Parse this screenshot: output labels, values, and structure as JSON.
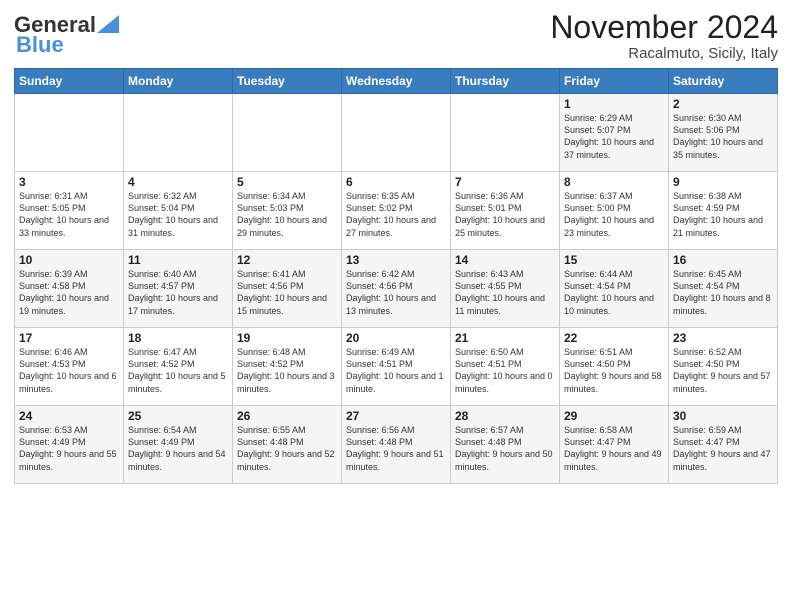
{
  "header": {
    "logo_general": "General",
    "logo_blue": "Blue",
    "month_title": "November 2024",
    "location": "Racalmuto, Sicily, Italy"
  },
  "days_of_week": [
    "Sunday",
    "Monday",
    "Tuesday",
    "Wednesday",
    "Thursday",
    "Friday",
    "Saturday"
  ],
  "weeks": [
    [
      {
        "day": "",
        "info": ""
      },
      {
        "day": "",
        "info": ""
      },
      {
        "day": "",
        "info": ""
      },
      {
        "day": "",
        "info": ""
      },
      {
        "day": "",
        "info": ""
      },
      {
        "day": "1",
        "info": "Sunrise: 6:29 AM\nSunset: 5:07 PM\nDaylight: 10 hours and 37 minutes."
      },
      {
        "day": "2",
        "info": "Sunrise: 6:30 AM\nSunset: 5:06 PM\nDaylight: 10 hours and 35 minutes."
      }
    ],
    [
      {
        "day": "3",
        "info": "Sunrise: 6:31 AM\nSunset: 5:05 PM\nDaylight: 10 hours and 33 minutes."
      },
      {
        "day": "4",
        "info": "Sunrise: 6:32 AM\nSunset: 5:04 PM\nDaylight: 10 hours and 31 minutes."
      },
      {
        "day": "5",
        "info": "Sunrise: 6:34 AM\nSunset: 5:03 PM\nDaylight: 10 hours and 29 minutes."
      },
      {
        "day": "6",
        "info": "Sunrise: 6:35 AM\nSunset: 5:02 PM\nDaylight: 10 hours and 27 minutes."
      },
      {
        "day": "7",
        "info": "Sunrise: 6:36 AM\nSunset: 5:01 PM\nDaylight: 10 hours and 25 minutes."
      },
      {
        "day": "8",
        "info": "Sunrise: 6:37 AM\nSunset: 5:00 PM\nDaylight: 10 hours and 23 minutes."
      },
      {
        "day": "9",
        "info": "Sunrise: 6:38 AM\nSunset: 4:59 PM\nDaylight: 10 hours and 21 minutes."
      }
    ],
    [
      {
        "day": "10",
        "info": "Sunrise: 6:39 AM\nSunset: 4:58 PM\nDaylight: 10 hours and 19 minutes."
      },
      {
        "day": "11",
        "info": "Sunrise: 6:40 AM\nSunset: 4:57 PM\nDaylight: 10 hours and 17 minutes."
      },
      {
        "day": "12",
        "info": "Sunrise: 6:41 AM\nSunset: 4:56 PM\nDaylight: 10 hours and 15 minutes."
      },
      {
        "day": "13",
        "info": "Sunrise: 6:42 AM\nSunset: 4:56 PM\nDaylight: 10 hours and 13 minutes."
      },
      {
        "day": "14",
        "info": "Sunrise: 6:43 AM\nSunset: 4:55 PM\nDaylight: 10 hours and 11 minutes."
      },
      {
        "day": "15",
        "info": "Sunrise: 6:44 AM\nSunset: 4:54 PM\nDaylight: 10 hours and 10 minutes."
      },
      {
        "day": "16",
        "info": "Sunrise: 6:45 AM\nSunset: 4:54 PM\nDaylight: 10 hours and 8 minutes."
      }
    ],
    [
      {
        "day": "17",
        "info": "Sunrise: 6:46 AM\nSunset: 4:53 PM\nDaylight: 10 hours and 6 minutes."
      },
      {
        "day": "18",
        "info": "Sunrise: 6:47 AM\nSunset: 4:52 PM\nDaylight: 10 hours and 5 minutes."
      },
      {
        "day": "19",
        "info": "Sunrise: 6:48 AM\nSunset: 4:52 PM\nDaylight: 10 hours and 3 minutes."
      },
      {
        "day": "20",
        "info": "Sunrise: 6:49 AM\nSunset: 4:51 PM\nDaylight: 10 hours and 1 minute."
      },
      {
        "day": "21",
        "info": "Sunrise: 6:50 AM\nSunset: 4:51 PM\nDaylight: 10 hours and 0 minutes."
      },
      {
        "day": "22",
        "info": "Sunrise: 6:51 AM\nSunset: 4:50 PM\nDaylight: 9 hours and 58 minutes."
      },
      {
        "day": "23",
        "info": "Sunrise: 6:52 AM\nSunset: 4:50 PM\nDaylight: 9 hours and 57 minutes."
      }
    ],
    [
      {
        "day": "24",
        "info": "Sunrise: 6:53 AM\nSunset: 4:49 PM\nDaylight: 9 hours and 55 minutes."
      },
      {
        "day": "25",
        "info": "Sunrise: 6:54 AM\nSunset: 4:49 PM\nDaylight: 9 hours and 54 minutes."
      },
      {
        "day": "26",
        "info": "Sunrise: 6:55 AM\nSunset: 4:48 PM\nDaylight: 9 hours and 52 minutes."
      },
      {
        "day": "27",
        "info": "Sunrise: 6:56 AM\nSunset: 4:48 PM\nDaylight: 9 hours and 51 minutes."
      },
      {
        "day": "28",
        "info": "Sunrise: 6:57 AM\nSunset: 4:48 PM\nDaylight: 9 hours and 50 minutes."
      },
      {
        "day": "29",
        "info": "Sunrise: 6:58 AM\nSunset: 4:47 PM\nDaylight: 9 hours and 49 minutes."
      },
      {
        "day": "30",
        "info": "Sunrise: 6:59 AM\nSunset: 4:47 PM\nDaylight: 9 hours and 47 minutes."
      }
    ]
  ]
}
